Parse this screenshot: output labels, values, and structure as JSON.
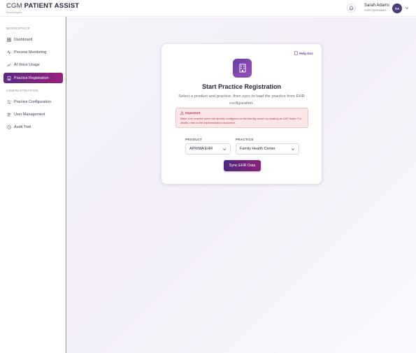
{
  "header": {
    "brand_prefix": "CGM",
    "brand_name": "PATIENT ASSIST",
    "brand_sub": "Preview Agent",
    "user_name": "Sarah Adams",
    "user_role": "CGM Operations",
    "avatar_initials": "SA"
  },
  "sidebar": {
    "sections": [
      {
        "title": "WORKSPACE",
        "items": [
          {
            "label": "Dashboard",
            "icon": "grid-icon"
          },
          {
            "label": "Process Monitoring",
            "icon": "activity-icon"
          },
          {
            "label": "AI Voice Usage",
            "icon": "waveform-icon"
          },
          {
            "label": "Practice Registration",
            "icon": "building-icon",
            "active": true
          }
        ]
      },
      {
        "title": "ADMINISTRATION",
        "items": [
          {
            "label": "Practice Configuration",
            "icon": "sliders-icon"
          },
          {
            "label": "User Management",
            "icon": "users-icon"
          },
          {
            "label": "Audit Trail",
            "icon": "clock-icon"
          }
        ]
      }
    ]
  },
  "card": {
    "help_label": "Help Doc",
    "title": "Start Practice Registration",
    "description": "Select a product and practice, then sync to load the practice from EHR configuration.",
    "alert": {
      "title": "Important",
      "text": "Make sure practice users are already configured on the identity server by creating an SAP ticket. For details, refer to the implementation document."
    },
    "product": {
      "label": "PRODUCT",
      "value": "APRIMA EHR"
    },
    "practice": {
      "label": "PRACTICE",
      "value": "Family Health Center"
    },
    "sync_label": "Sync EHR Data"
  },
  "colors": {
    "accent": "#5b2a86",
    "accent_end": "#9a1f7d",
    "alert_bg": "#fbe6e8",
    "alert_text": "#c3323f"
  }
}
